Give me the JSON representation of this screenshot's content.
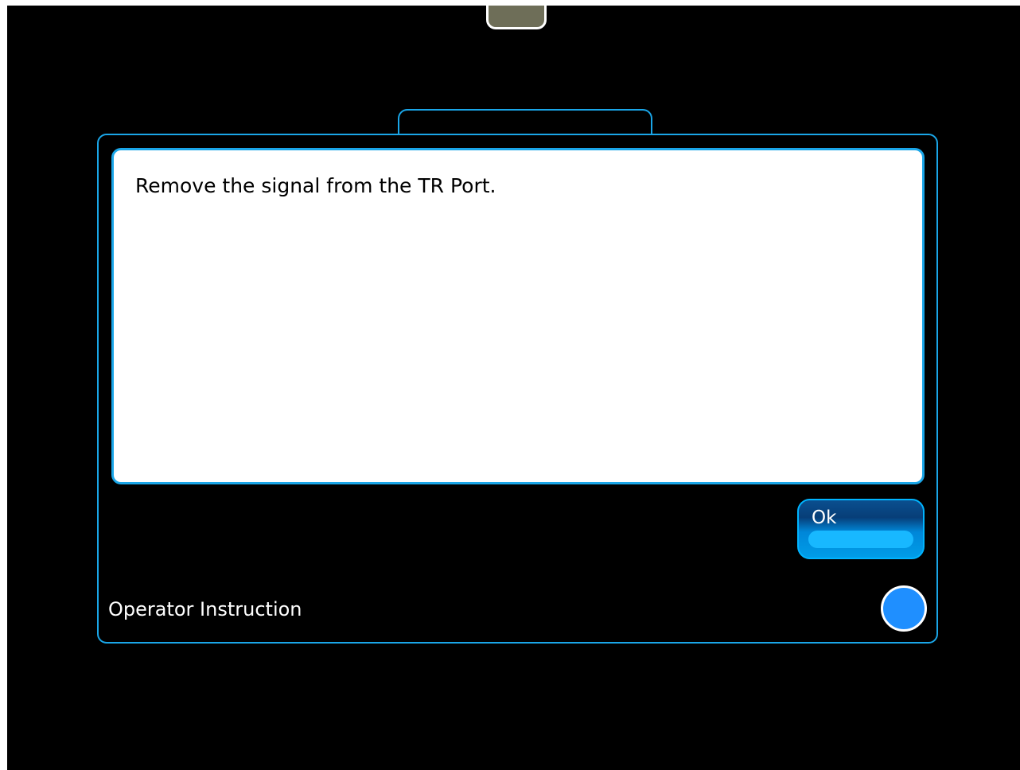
{
  "dialog": {
    "message": "Remove the signal from the TR Port.",
    "ok_label": "Ok",
    "caption": "Operator Instruction"
  },
  "colors": {
    "background": "#000000",
    "accent": "#1aa6e8",
    "status_dot": "#1f8fff",
    "handle": "#6e6e58"
  },
  "icons": {
    "top_handle": "pull-tab-handle",
    "status": "status-indicator-icon"
  }
}
